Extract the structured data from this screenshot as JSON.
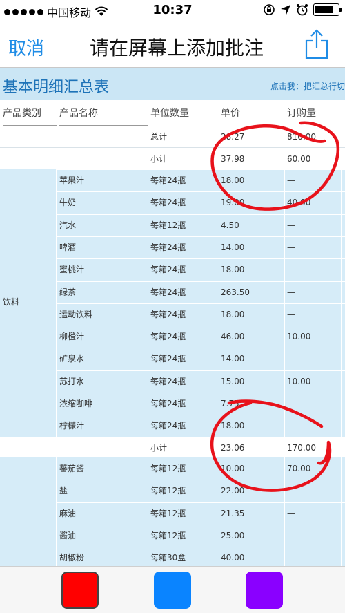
{
  "status": {
    "carrier": "中国移动",
    "time": "10:37",
    "signal_bars": 5,
    "battery_level": 0.85
  },
  "nav": {
    "cancel_label": "取消",
    "title": "请在屏幕上添加批注",
    "share_icon": "share-icon"
  },
  "table": {
    "banner_title": "基本明细汇总表",
    "banner_link": "点击我：把汇总行切",
    "headers": [
      "产品类别",
      "产品名称",
      "单位数量",
      "单价",
      "订购量"
    ],
    "total_row": {
      "label": "总计",
      "price": "28.27",
      "qty": "810.00"
    },
    "subtotal_top": {
      "label": "小计",
      "price": "37.98",
      "qty": "60.00"
    },
    "group1": {
      "category": "饮料",
      "rows": [
        {
          "name": "苹果汁",
          "unit": "每箱24瓶",
          "price": "18.00",
          "qty": "—"
        },
        {
          "name": "牛奶",
          "unit": "每箱24瓶",
          "price": "19.00",
          "qty": "40.00"
        },
        {
          "name": "汽水",
          "unit": "每箱12瓶",
          "price": "4.50",
          "qty": "—"
        },
        {
          "name": "啤酒",
          "unit": "每箱24瓶",
          "price": "14.00",
          "qty": "—"
        },
        {
          "name": "蜜桃汁",
          "unit": "每箱24瓶",
          "price": "18.00",
          "qty": "—"
        },
        {
          "name": "绿茶",
          "unit": "每箱24瓶",
          "price": "263.50",
          "qty": "—"
        },
        {
          "name": "运动饮料",
          "unit": "每箱24瓶",
          "price": "18.00",
          "qty": "—"
        },
        {
          "name": "柳橙汁",
          "unit": "每箱24瓶",
          "price": "46.00",
          "qty": "10.00"
        },
        {
          "name": "矿泉水",
          "unit": "每箱24瓶",
          "price": "14.00",
          "qty": "—"
        },
        {
          "name": "苏打水",
          "unit": "每箱24瓶",
          "price": "15.00",
          "qty": "10.00"
        },
        {
          "name": "浓缩咖啡",
          "unit": "每箱24瓶",
          "price": "7.75",
          "qty": "—"
        },
        {
          "name": "柠檬汁",
          "unit": "每箱24瓶",
          "price": "18.00",
          "qty": "—"
        }
      ]
    },
    "subtotal_mid": {
      "label": "小计",
      "price": "23.06",
      "qty": "170.00"
    },
    "group2": {
      "rows": [
        {
          "name": "蕃茄酱",
          "unit": "每箱12瓶",
          "price": "10.00",
          "qty": "70.00"
        },
        {
          "name": "盐",
          "unit": "每箱12瓶",
          "price": "22.00",
          "qty": "—"
        },
        {
          "name": "麻油",
          "unit": "每箱12瓶",
          "price": "21.35",
          "qty": "—"
        },
        {
          "name": "酱油",
          "unit": "每箱12瓶",
          "price": "25.00",
          "qty": "—"
        },
        {
          "name": "胡椒粉",
          "unit": "每箱30盒",
          "price": "40.00",
          "qty": "—"
        }
      ]
    }
  },
  "toolbar": {
    "colors": [
      "#ff0000",
      "#0a84ff",
      "#8a00ff"
    ],
    "selected_index": 0
  },
  "annotation_color": "#e8121b"
}
